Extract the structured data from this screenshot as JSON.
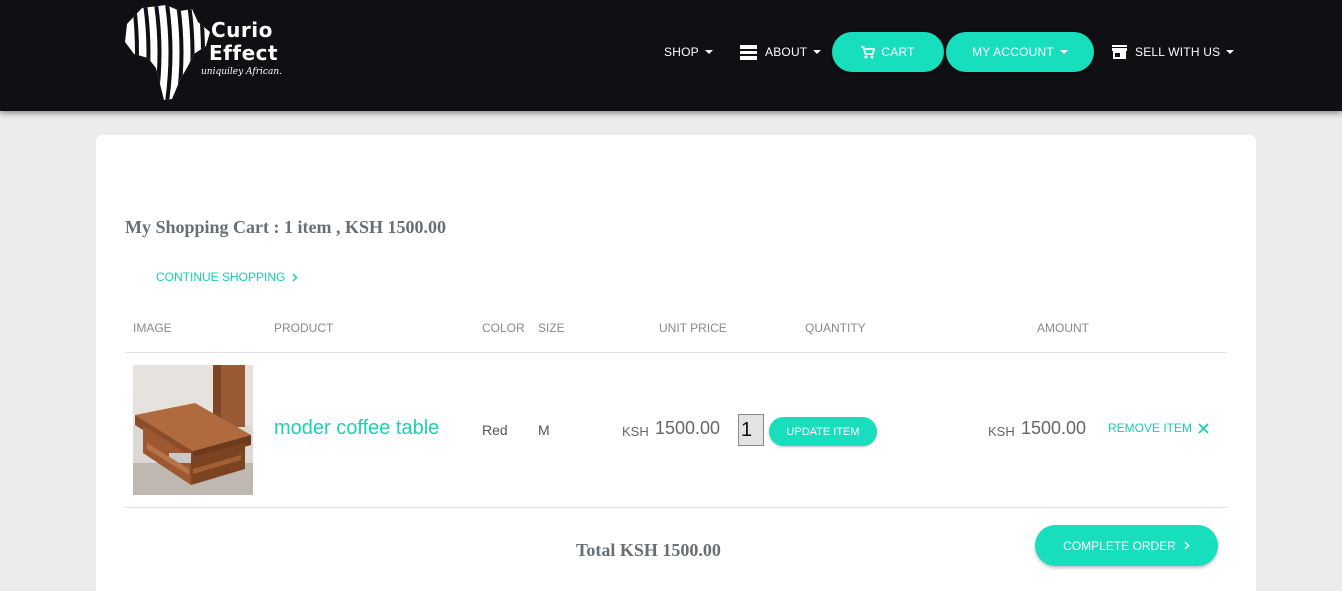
{
  "brand": {
    "name_line1": "Curio",
    "name_line2": "Effect",
    "tagline": "uniquiley African."
  },
  "nav": {
    "shop": "SHOP",
    "about": "ABOUT",
    "cart": "CART",
    "account": "MY ACCOUNT",
    "sell": "SELL WITH US"
  },
  "cart": {
    "heading": "My Shopping Cart : 1 item , KSH 1500.00",
    "continue_label": "CONTINUE SHOPPING",
    "columns": [
      "IMAGE",
      "PRODUCT",
      "COLOR",
      "SIZE",
      "UNIT PRICE",
      "QUANTITY",
      "AMOUNT"
    ],
    "items": [
      {
        "product": "moder coffee table",
        "color": "Red",
        "size": "M",
        "currency": "KSH",
        "unit_price": "1500.00",
        "quantity": "1",
        "amount": "1500.00",
        "update_label": "UPDATE ITEM",
        "remove_label": "REMOVE ITEM"
      }
    ],
    "total": "Total KSH 1500.00",
    "complete_label": "COMPLETE ORDER"
  },
  "theme": {
    "accent": "#17dfbd",
    "nav_bg": "#0f0f14",
    "page_bg": "#ececec"
  },
  "icons": [
    "africa-logo-icon",
    "dropdown-caret-icon",
    "menu-bars-icon",
    "cart-icon",
    "store-icon",
    "chevron-right-icon",
    "close-icon"
  ]
}
